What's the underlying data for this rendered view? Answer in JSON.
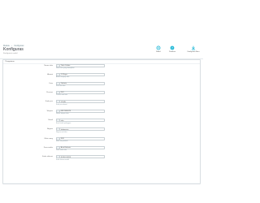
{
  "header": {
    "breadcrumb": [
      "Module",
      "Konfigurasi"
    ],
    "title": "Konfiguras",
    "subtitle": "Konfigurasi modul"
  },
  "toolbar": {
    "items": [
      {
        "label": "Modul",
        "icon": "gear-icon"
      },
      {
        "label": "Panduan",
        "icon": "help-icon"
      },
      {
        "label": "Konfigurasi Baru",
        "icon": "download-icon"
      }
    ],
    "accent": "#25b9d7"
  },
  "panel": {
    "title": "Pengaturan",
    "fields": [
      {
        "label": "Nama toko",
        "value": "Toko Online",
        "hint": "Nama toko yang ditampilkan"
      },
      {
        "label": "Alamat",
        "value": "Jl. Raya",
        "hint": "Alamat lengkap toko"
      },
      {
        "label": "Kota",
        "value": "Jakarta",
        "hint": "Kota asal toko"
      },
      {
        "label": "Provinsi",
        "value": "DKI",
        "hint": "Provinsi asal toko"
      },
      {
        "label": "Kode pos",
        "value": "12345",
        "hint": "Kode pos alamat"
      },
      {
        "label": "Telepon",
        "value": "0812345678",
        "hint": "Nomor telepon toko"
      },
      {
        "label": "Email",
        "value": "info",
        "hint": "Email untuk pelanggan"
      },
      {
        "label": "Negara",
        "value": "Indonesia",
        "hint": "Negara asal toko"
      },
      {
        "label": "Mata uang",
        "value": "IDR",
        "hint": "Mata uang default"
      },
      {
        "label": "Zona waktu",
        "value": "Asia/Jakarta",
        "hint": "Zona waktu toko"
      },
      {
        "label": "Kode aktivasi",
        "value": "XXXX-XXXX",
        "hint": "Kode aktivasi modul"
      }
    ]
  }
}
